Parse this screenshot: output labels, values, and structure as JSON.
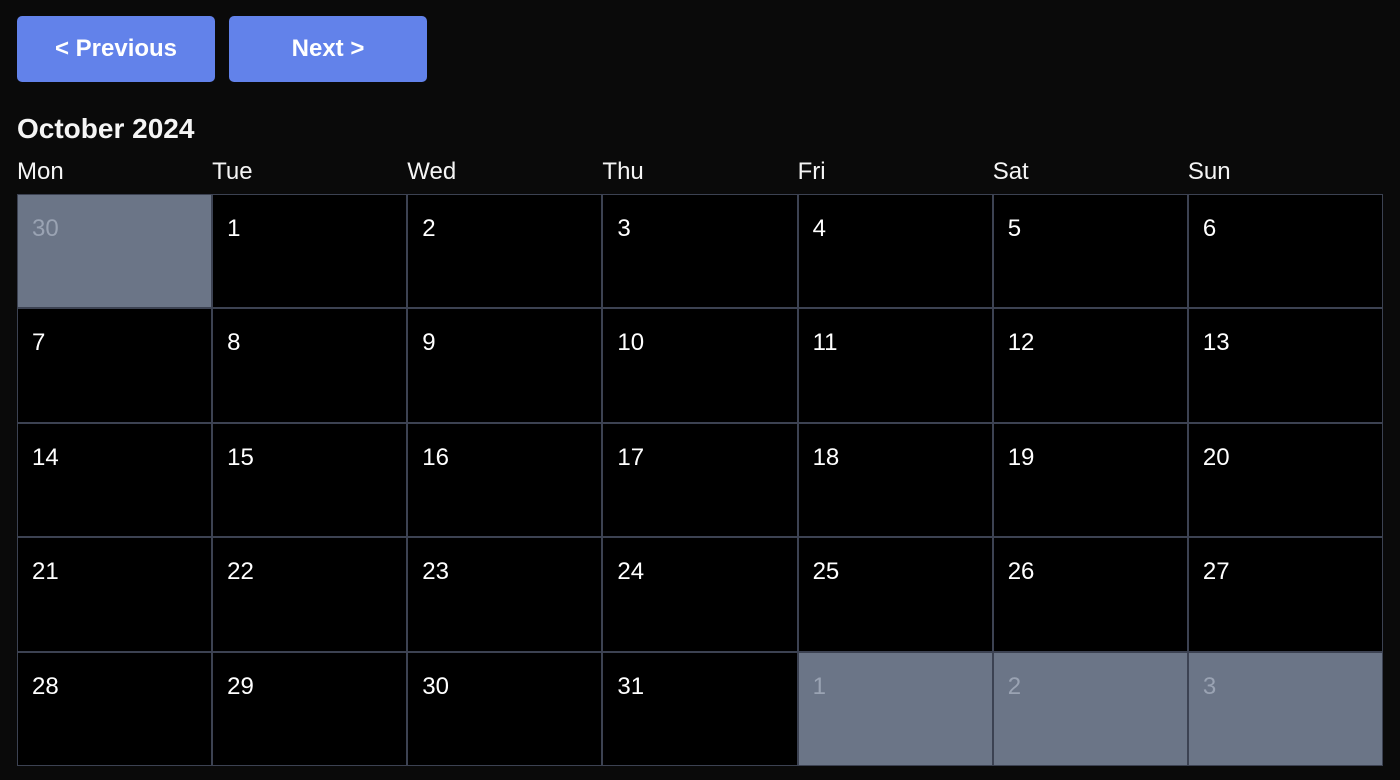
{
  "nav": {
    "previous_label": "< Previous",
    "next_label": "Next >"
  },
  "calendar": {
    "title": "October 2024",
    "weekdays": [
      "Mon",
      "Tue",
      "Wed",
      "Thu",
      "Fri",
      "Sat",
      "Sun"
    ],
    "weeks": [
      [
        {
          "day": "30",
          "other": true
        },
        {
          "day": "1"
        },
        {
          "day": "2"
        },
        {
          "day": "3"
        },
        {
          "day": "4"
        },
        {
          "day": "5"
        },
        {
          "day": "6"
        }
      ],
      [
        {
          "day": "7"
        },
        {
          "day": "8"
        },
        {
          "day": "9"
        },
        {
          "day": "10"
        },
        {
          "day": "11"
        },
        {
          "day": "12"
        },
        {
          "day": "13"
        }
      ],
      [
        {
          "day": "14"
        },
        {
          "day": "15"
        },
        {
          "day": "16"
        },
        {
          "day": "17"
        },
        {
          "day": "18"
        },
        {
          "day": "19"
        },
        {
          "day": "20"
        }
      ],
      [
        {
          "day": "21"
        },
        {
          "day": "22"
        },
        {
          "day": "23"
        },
        {
          "day": "24"
        },
        {
          "day": "25"
        },
        {
          "day": "26"
        },
        {
          "day": "27"
        }
      ],
      [
        {
          "day": "28"
        },
        {
          "day": "29"
        },
        {
          "day": "30"
        },
        {
          "day": "31"
        },
        {
          "day": "1",
          "other": true
        },
        {
          "day": "2",
          "other": true
        },
        {
          "day": "3",
          "other": true
        }
      ]
    ]
  },
  "colors": {
    "button": "#6282ea",
    "page_background": "#0a0a0a",
    "cell_background": "#000000",
    "other_month_background": "#6b7587",
    "border": "#3c4252"
  }
}
